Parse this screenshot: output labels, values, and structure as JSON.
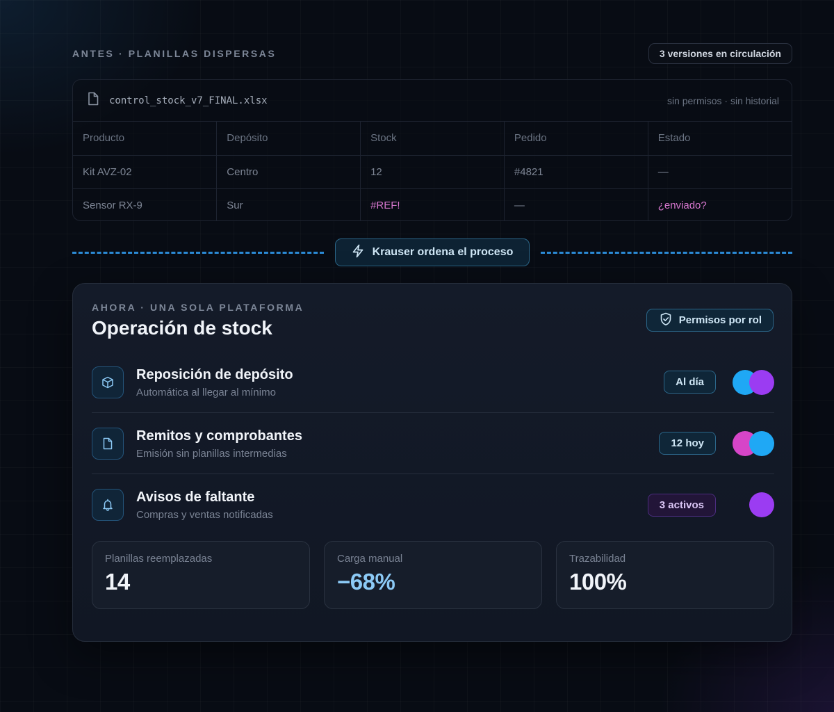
{
  "before": {
    "eyebrow": "ANTES · PLANILLAS DISPERSAS",
    "versions_badge": "3 versiones en circulación",
    "file_icon": "file-icon",
    "file_name": "control_stock_v7_FINAL.xlsx",
    "file_meta": "sin permisos · sin historial",
    "columns": [
      "Producto",
      "Depósito",
      "Stock",
      "Pedido",
      "Estado"
    ],
    "rows": [
      [
        "Kit AVZ-02",
        "Centro",
        "12",
        "#4821",
        "—"
      ],
      [
        "Sensor RX-9",
        "Sur",
        "#REF!",
        "—",
        "¿enviado?"
      ]
    ],
    "error_color": "#d978d0"
  },
  "divider": {
    "icon": "lightning-icon",
    "label": "Krauser ordena el proceso",
    "line_color": "#2c8bd6"
  },
  "after": {
    "eyebrow": "AHORA · UNA SOLA PLATAFORMA",
    "title": "Operación de stock",
    "role_badge": {
      "icon": "shield-check-icon",
      "label": "Permisos por rol"
    },
    "rows": [
      {
        "icon": "box-icon",
        "title": "Reposición de depósito",
        "subtitle": "Automática al llegar al mínimo",
        "badge": "Al día",
        "badge_style": "blue",
        "avatars": [
          "#1fa8f5",
          "#9b3cf2"
        ]
      },
      {
        "icon": "document-icon",
        "title": "Remitos y comprobantes",
        "subtitle": "Emisión sin planillas intermedias",
        "badge": "12 hoy",
        "badge_style": "blue",
        "avatars": [
          "#d645c8",
          "#1fa8f5"
        ]
      },
      {
        "icon": "bell-icon",
        "title": "Avisos de faltante",
        "subtitle": "Compras y ventas notificadas",
        "badge": "3 activos",
        "badge_style": "purple",
        "avatars": [
          "#9b3cf2"
        ]
      }
    ],
    "stats": [
      {
        "label": "Planillas reemplazadas",
        "value": "14",
        "accent": false
      },
      {
        "label": "Carga manual",
        "value": "−68%",
        "accent": true
      },
      {
        "label": "Trazabilidad",
        "value": "100%",
        "accent": false
      }
    ]
  }
}
